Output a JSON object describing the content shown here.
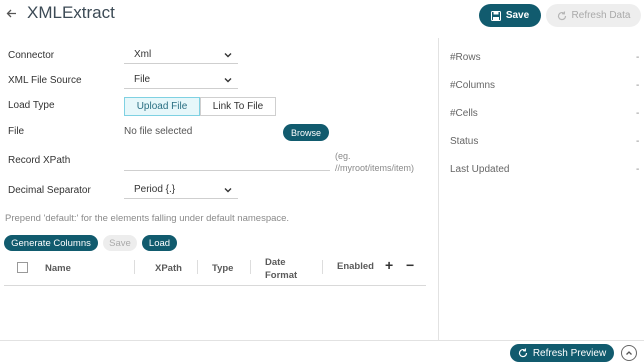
{
  "header": {
    "title": "XMLExtract",
    "save_label": "Save",
    "refresh_data_label": "Refresh Data"
  },
  "form": {
    "connector": {
      "label": "Connector",
      "value": "Xml"
    },
    "xml_file_source": {
      "label": "XML File Source",
      "value": "File"
    },
    "load_type": {
      "label": "Load Type",
      "options": [
        "Upload File",
        "Link To File"
      ],
      "selected": "Upload File"
    },
    "file": {
      "label": "File",
      "status": "No file selected",
      "browse_label": "Browse"
    },
    "record_xpath": {
      "label": "Record XPath",
      "value": "",
      "hint_line1": "(eg.",
      "hint_line2": "//myroot/items/item)"
    },
    "decimal_separator": {
      "label": "Decimal Separator",
      "value": "Period {.}"
    }
  },
  "note": "Prepend 'default:' for the elements falling under default namespace.",
  "actions": {
    "generate_columns": "Generate Columns",
    "save": "Save",
    "load": "Load"
  },
  "grid": {
    "columns": [
      "Name",
      "XPath",
      "Type",
      "Date Format",
      "Enabled"
    ],
    "date_format_line1": "Date",
    "date_format_line2": "Format"
  },
  "stats": [
    {
      "label": "#Rows",
      "value": "-"
    },
    {
      "label": "#Columns",
      "value": "-"
    },
    {
      "label": "#Cells",
      "value": "-"
    },
    {
      "label": "Status",
      "value": "-"
    },
    {
      "label": "Last Updated",
      "value": "-"
    }
  ],
  "footer": {
    "refresh_preview_label": "Refresh Preview"
  },
  "colors": {
    "primary": "#115b6e",
    "active_segment_bg": "#e6f7fa",
    "disabled_bg": "#eeeeee"
  },
  "icons": [
    "back-arrow-icon",
    "save-disk-icon",
    "refresh-icon",
    "chevron-down-icon",
    "plus-icon",
    "minus-icon",
    "chevron-up-icon"
  ]
}
